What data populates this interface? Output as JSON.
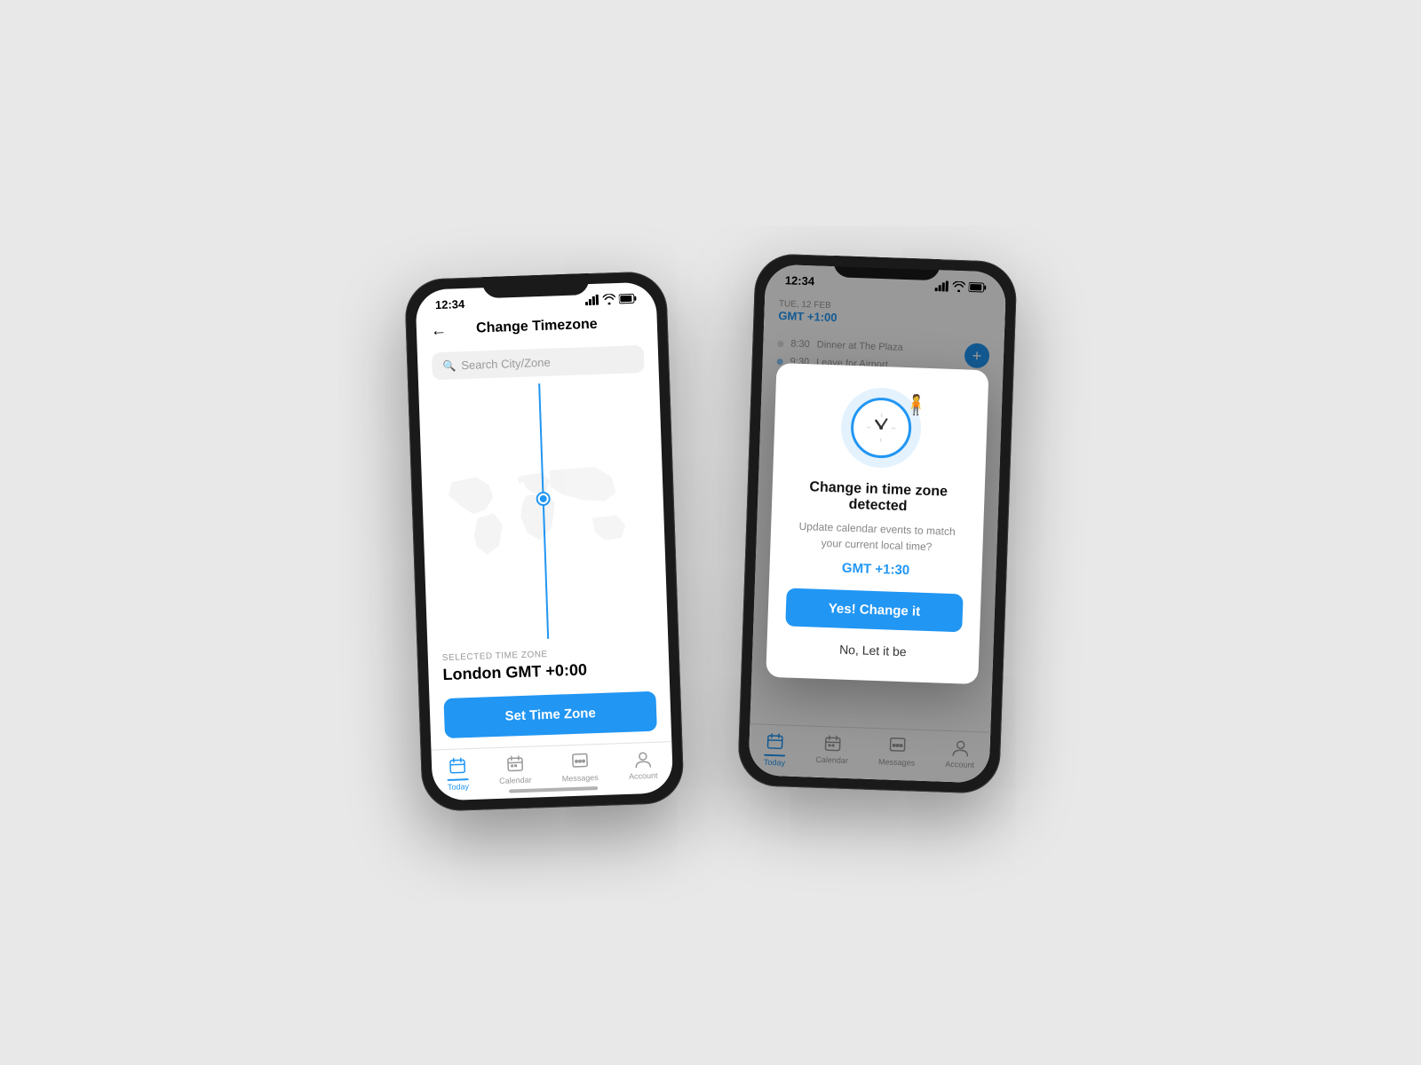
{
  "background": "#e8e8e8",
  "phone1": {
    "status_time": "12:34",
    "title": "Change Timezone",
    "search_placeholder": "Search City/Zone",
    "selected_zone_label": "SELECTED TIME ZONE",
    "selected_zone_value": "London GMT +0:00",
    "set_button_label": "Set Time Zone",
    "tabs": [
      {
        "id": "today",
        "label": "Today",
        "active": true
      },
      {
        "id": "calendar",
        "label": "Calendar",
        "active": false
      },
      {
        "id": "messages",
        "label": "Messages",
        "active": false
      },
      {
        "id": "account",
        "label": "Account",
        "active": false
      }
    ]
  },
  "phone2": {
    "status_time": "12:34",
    "date_label": "TUE, 12 FEB",
    "gmt_label": "GMT +1:00",
    "modal": {
      "title": "Change in time zone detected",
      "description": "Update calendar events to match your current local time?",
      "gmt_value": "GMT +1:30",
      "confirm_label": "Yes! Change it",
      "cancel_label": "No, Let it be"
    },
    "events": [
      {
        "time": "8:30",
        "title": "Dinner at The Plaza",
        "color": "#999"
      },
      {
        "time": "9:30",
        "title": "Leave for Airport",
        "color": "#2196F3"
      }
    ],
    "tabs": [
      {
        "id": "today",
        "label": "Today",
        "active": true
      },
      {
        "id": "calendar",
        "label": "Calendar",
        "active": false
      },
      {
        "id": "messages",
        "label": "Messages",
        "active": false
      },
      {
        "id": "account",
        "label": "Account",
        "active": false
      }
    ]
  }
}
